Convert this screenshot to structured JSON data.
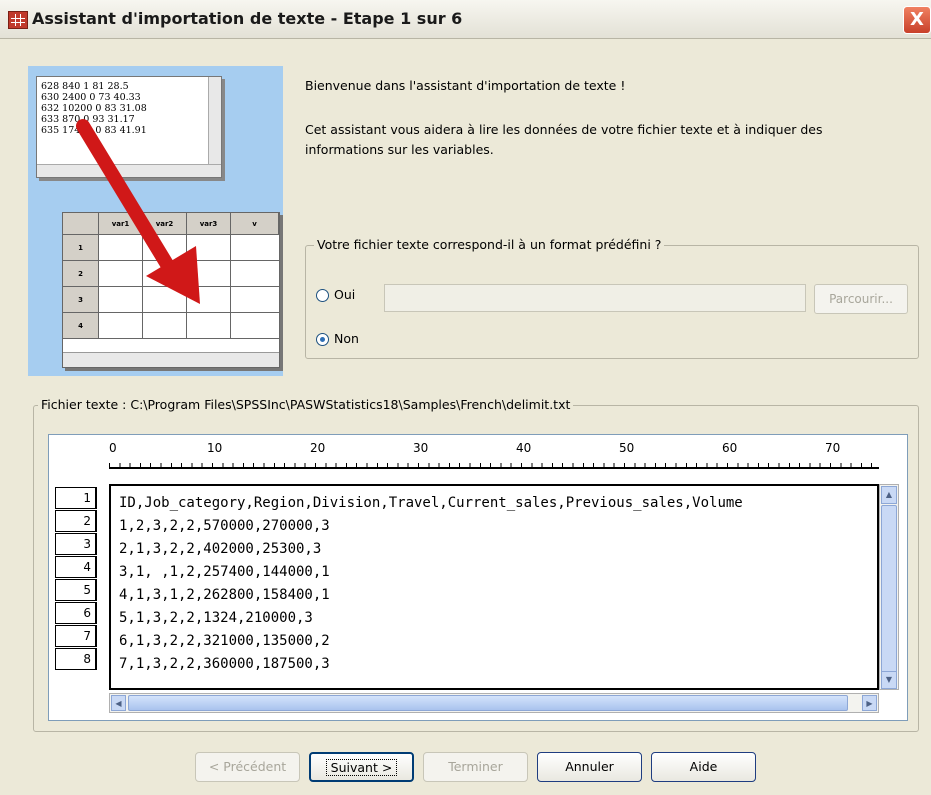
{
  "window": {
    "title": "Assistant d'importation de texte - Etape 1 sur 6",
    "close_label": "X"
  },
  "illustration": {
    "text_lines": [
      "628 840 1 81 28.5",
      "630 2400 0 73 40.33",
      "632 10200 0 83 31.08",
      "633 870 0 93 31.17",
      "635 17400 0 83 41.91"
    ],
    "grid_headers": [
      "var1",
      "var2",
      "var3",
      "v"
    ],
    "grid_rows": [
      "1",
      "2",
      "3",
      "4"
    ]
  },
  "intro": {
    "welcome": "Bienvenue dans l'assistant d'importation de texte !",
    "description": "Cet assistant vous aidera à lire les données de votre fichier texte et à indiquer des informations sur les variables."
  },
  "format_group": {
    "legend": "Votre fichier texte correspond-il à un format prédéfini ?",
    "oui_label": "Oui",
    "non_label": "Non",
    "selected": "Non",
    "path_value": "",
    "browse_label": "Parcourir..."
  },
  "file_group": {
    "legend": "Fichier texte : C:\\Program Files\\SPSSInc\\PASWStatistics18\\Samples\\French\\delimit.txt",
    "ruler_labels": [
      "0",
      "10",
      "20",
      "30",
      "40",
      "50",
      "60",
      "70"
    ],
    "row_numbers": [
      "1",
      "2",
      "3",
      "4",
      "5",
      "6",
      "7",
      "8"
    ],
    "lines": [
      "ID,Job_category,Region,Division,Travel,Current_sales,Previous_sales,Volume",
      "1,2,3,2,2,570000,270000,3",
      "2,1,3,2,2,402000,25300,3",
      "3,1, ,1,2,257400,144000,1",
      "4,1,3,1,2,262800,158400,1",
      "5,1,3,2,2,1324,210000,3",
      "6,1,3,2,2,321000,135000,2",
      "7,1,3,2,2,360000,187500,3"
    ]
  },
  "buttons": {
    "previous": "< Précédent",
    "next": "Suivant >",
    "finish": "Terminer",
    "cancel": "Annuler",
    "help": "Aide"
  }
}
